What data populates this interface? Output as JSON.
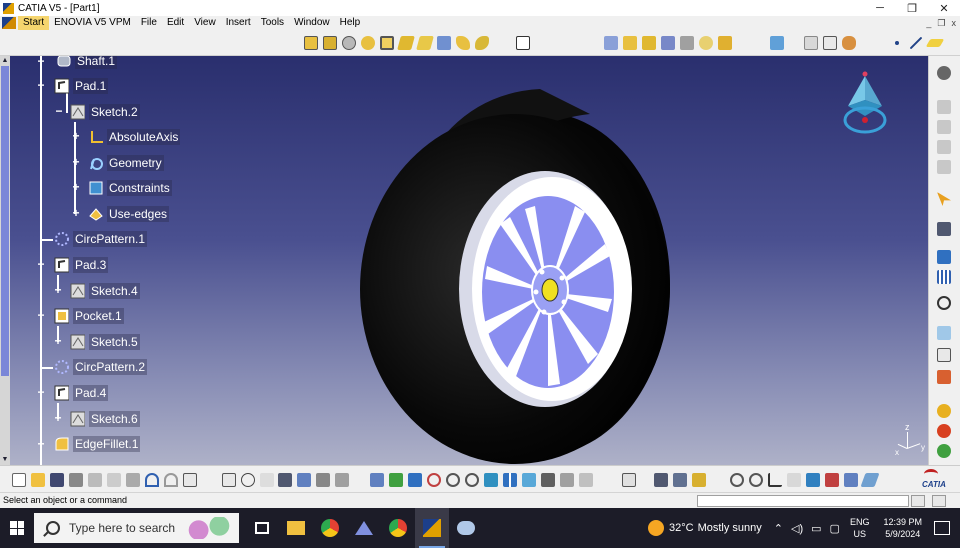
{
  "window": {
    "title": "CATIA V5 - [Part1]",
    "controls": {
      "minimize": "─",
      "restore": "❐",
      "close": "✕"
    }
  },
  "menubar": {
    "items": [
      "Start",
      "ENOVIA V5 VPM",
      "File",
      "Edit",
      "View",
      "Insert",
      "Tools",
      "Window",
      "Help"
    ],
    "mdi": {
      "minimize": "_",
      "restore": "❐",
      "close": "x"
    }
  },
  "tree": {
    "items": [
      {
        "label": "Shaft.1",
        "level": 0,
        "icon": "shaft-icon"
      },
      {
        "label": "Pad.1",
        "level": 0,
        "icon": "pad-icon"
      },
      {
        "label": "Sketch.2",
        "level": 1,
        "icon": "sketch-icon"
      },
      {
        "label": "AbsoluteAxis",
        "level": 2,
        "icon": "axis-icon"
      },
      {
        "label": "Geometry",
        "level": 2,
        "icon": "geometry-icon"
      },
      {
        "label": "Constraints",
        "level": 2,
        "icon": "constraints-icon"
      },
      {
        "label": "Use-edges",
        "level": 2,
        "icon": "use-edges-icon"
      },
      {
        "label": "CircPattern.1",
        "level": 0,
        "icon": "circpattern-icon"
      },
      {
        "label": "Pad.3",
        "level": 0,
        "icon": "pad-icon"
      },
      {
        "label": "Sketch.4",
        "level": 1,
        "icon": "sketch-icon"
      },
      {
        "label": "Pocket.1",
        "level": 0,
        "icon": "pocket-icon"
      },
      {
        "label": "Sketch.5",
        "level": 1,
        "icon": "sketch-icon"
      },
      {
        "label": "CircPattern.2",
        "level": 0,
        "icon": "circpattern-icon"
      },
      {
        "label": "Pad.4",
        "level": 0,
        "icon": "pad-icon"
      },
      {
        "label": "Sketch.6",
        "level": 1,
        "icon": "sketch-icon"
      },
      {
        "label": "EdgeFillet.1",
        "level": 0,
        "icon": "edgefillet-icon"
      }
    ]
  },
  "compass": {
    "axis_label": "z"
  },
  "axis_indicator": {
    "z": "z",
    "x": "x",
    "y": "y"
  },
  "catia_logo": "CATIA",
  "status": {
    "message": "Select an object or a command",
    "command_input": ""
  },
  "taskbar": {
    "search_placeholder": "Type here to search",
    "weather": {
      "temp": "32°C",
      "condition": "Mostly sunny"
    },
    "language": {
      "line1": "ENG",
      "line2": "US"
    },
    "clock": {
      "time": "12:39 PM",
      "date": "5/9/2024"
    }
  },
  "colors": {
    "viewport_top": "#2a2f6e",
    "viewport_bottom": "#aeb1c8",
    "rim": "#8a8ef0",
    "hub": "#f0e020",
    "tire": "#0a0a0a",
    "start_highlight": "#f5d56e"
  }
}
